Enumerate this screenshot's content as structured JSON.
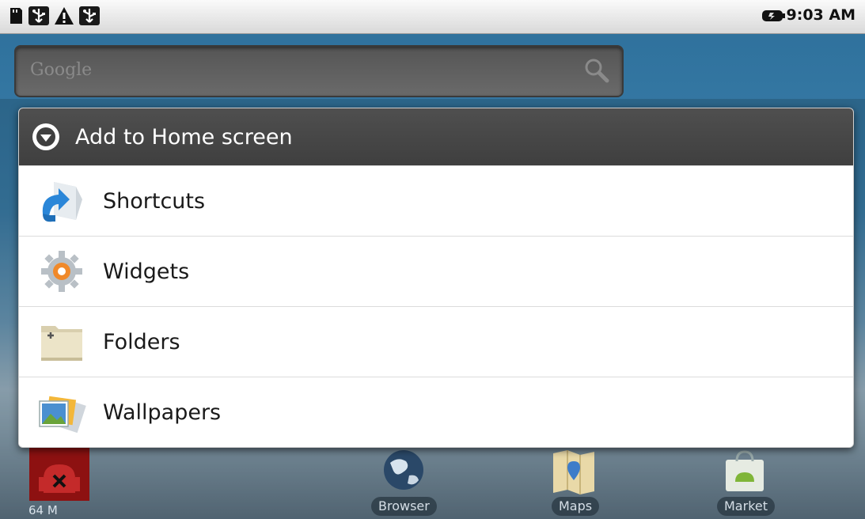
{
  "status_bar": {
    "clock": "9:03 AM",
    "left_icons": [
      "sd-card-icon",
      "usb-icon",
      "warning-icon",
      "usb-icon"
    ],
    "right_icons": [
      "battery-icon"
    ]
  },
  "search": {
    "placeholder": "Google"
  },
  "dialog": {
    "title": "Add to Home screen",
    "items": [
      {
        "label": "Shortcuts",
        "icon": "shortcut-icon"
      },
      {
        "label": "Widgets",
        "icon": "widgets-gear-icon"
      },
      {
        "label": "Folders",
        "icon": "folder-icon"
      },
      {
        "label": "Wallpapers",
        "icon": "wallpapers-icon"
      }
    ]
  },
  "dock": {
    "widget_text": "64 M",
    "apps": [
      {
        "label": "Browser"
      },
      {
        "label": "Maps"
      },
      {
        "label": "Market"
      }
    ]
  },
  "colors": {
    "dialog_header": "#444444",
    "accent_blue": "#2a86d8",
    "widget_red": "#9a1212"
  }
}
